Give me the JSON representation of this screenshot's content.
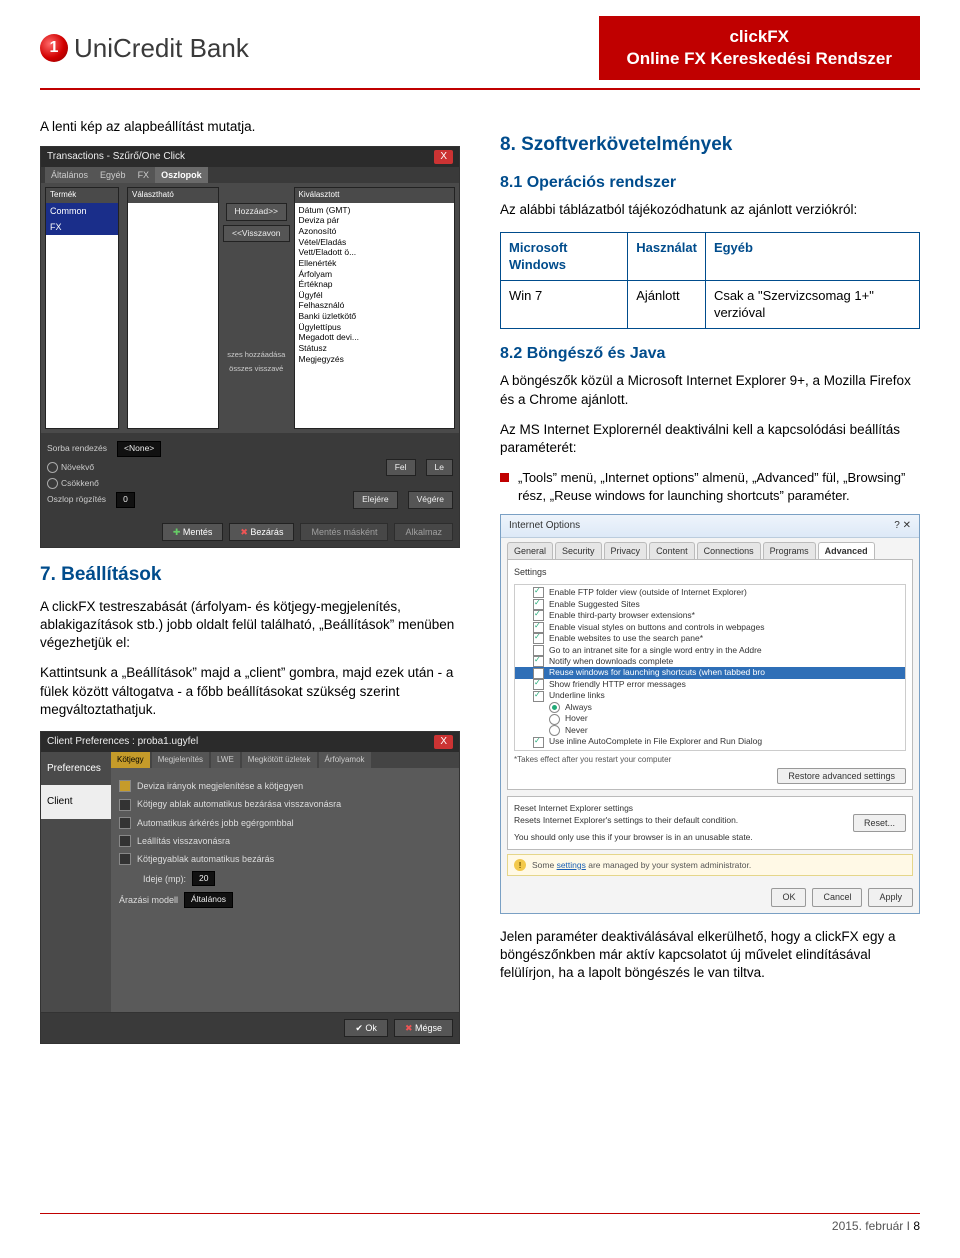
{
  "header": {
    "logo_text": "UniCredit Bank",
    "box_line1": "clickFX",
    "box_line2": "Online FX Kereskedési Rendszer"
  },
  "left": {
    "intro": "A lenti kép az alapbeállítást mutatja.",
    "shot1": {
      "title": "Transactions - Szűrő/One Click",
      "close": "X",
      "tabs": [
        "Általános",
        "Egyéb",
        "FX",
        "Oszlopok"
      ],
      "col1_hdr": "Termék",
      "col1_items": [
        "Common",
        "FX"
      ],
      "col2_hdr": "Választható",
      "col3_hdr": "Kiválasztott",
      "mid_btns": [
        "Hozzáad>>",
        "<<Visszavon"
      ],
      "selected": [
        "Dátum (GMT)",
        "Deviza pár",
        "Azonosító",
        "Vétel/Eladás",
        "Vett/Eladott ö...",
        "Ellenérték",
        "Árfolyam",
        "Értéknap",
        "Ügyfél",
        "Felhasználó",
        "Banki üzletkötő",
        "Ügylettípus",
        "Megadott devi...",
        "Státusz",
        "Megjegyzés"
      ],
      "extra1": "szes hozzáadása",
      "extra2": "összes visszavé",
      "sort_label": "Sorba rendezés",
      "sort_value": "<None>",
      "r_up": "Növekvő",
      "r_down": "Csökkenő",
      "fix_label": "Oszlop rögzítés",
      "fix_value": "0",
      "btns_fl": [
        "Fel",
        "Le"
      ],
      "btns_ev": [
        "Elejére",
        "Végére"
      ],
      "foot": [
        "Mentés",
        "Bezárás",
        "Mentés másként",
        "Alkalmaz"
      ]
    },
    "h7": "7. Beállítások",
    "p7a": "A clickFX testreszabását (árfolyam- és kötjegy-megjelenítés, ablakigazítások stb.) jobb oldalt felül található, „Beállítások” menüben végezhetjük el:",
    "p7b": "Kattintsunk a „Beállítások” majd a „client” gombra, majd ezek után - a fülek között váltogatva - a főbb beállításokat szükség szerint megváltoztathatjuk.",
    "shot2": {
      "title": "Client Preferences : proba1.ugyfel",
      "close": "X",
      "side": [
        "Preferences",
        "Client"
      ],
      "tabs": [
        "Kötjegy",
        "Megjelenítés",
        "LWE",
        "Megkötött üzletek",
        "Árfolyamok"
      ],
      "rows": [
        {
          "on": true,
          "label": "Deviza irányok megjelenítése a kötjegyen"
        },
        {
          "on": false,
          "label": "Kötjegy ablak automatikus bezárása visszavonásra"
        },
        {
          "on": false,
          "label": "Automatikus árkérés jobb egérgombbal"
        },
        {
          "on": false,
          "label": "Leállítás visszavonásra"
        },
        {
          "on": false,
          "label": "Kötjegyablak automatikus bezárás"
        }
      ],
      "time_label": "Ideje (mp):",
      "time_value": "20",
      "model_label": "Árazási modell",
      "model_value": "Általános",
      "foot_ok": "Ok",
      "foot_cancel": "Mégse"
    }
  },
  "right": {
    "h8": "8. Szoftverkövetelmények",
    "h81": "8.1 Operációs rendszer",
    "p81": "Az alábbi táblázatból tájékozódhatunk az ajánlott verziókról:",
    "table": {
      "headers": [
        "Microsoft Windows",
        "Használat",
        "Egyéb"
      ],
      "row": [
        "Win 7",
        "Ajánlott",
        "Csak a \"Szervizcsomag 1+\" verzióval"
      ]
    },
    "h82": "8.2 Böngésző és Java",
    "p82a": "A böngészők közül a Microsoft Internet Explorer 9+, a Mozilla Firefox és a Chrome ajánlott.",
    "p82b": "Az MS Internet Explorernél deaktiválni kell a kapcsolódási beállítás paraméterét:",
    "bullet": "„Tools” menü, „Internet options” almenü, „Advanced” fül, „Browsing” rész, „Reuse windows for launching shortcuts” paraméter.",
    "ie": {
      "title": "Internet Options",
      "tabs": [
        "General",
        "Security",
        "Privacy",
        "Content",
        "Connections",
        "Programs",
        "Advanced"
      ],
      "group": "Settings",
      "rows": [
        {
          "t": "chk",
          "on": true,
          "label": "Enable FTP folder view (outside of Internet Explorer)"
        },
        {
          "t": "chk",
          "on": true,
          "label": "Enable Suggested Sites"
        },
        {
          "t": "chk",
          "on": true,
          "label": "Enable third-party browser extensions*"
        },
        {
          "t": "chk",
          "on": true,
          "label": "Enable visual styles on buttons and controls in webpages"
        },
        {
          "t": "chk",
          "on": true,
          "label": "Enable websites to use the search pane*"
        },
        {
          "t": "chk",
          "on": false,
          "label": "Go to an intranet site for a single word entry in the Addre"
        },
        {
          "t": "chk",
          "on": true,
          "label": "Notify when downloads complete"
        },
        {
          "t": "chk",
          "on": false,
          "hl": true,
          "label": "Reuse windows for launching shortcuts (when tabbed bro"
        },
        {
          "t": "chk",
          "on": true,
          "label": "Show friendly HTTP error messages"
        },
        {
          "t": "chk",
          "on": true,
          "label": "Underline links",
          "indent": false
        },
        {
          "t": "radio",
          "on": true,
          "label": "Always",
          "indent": true
        },
        {
          "t": "radio",
          "on": false,
          "label": "Hover",
          "indent": true
        },
        {
          "t": "radio",
          "on": false,
          "label": "Never",
          "indent": true
        },
        {
          "t": "chk",
          "on": true,
          "label": "Use inline AutoComplete in File Explorer and Run Dialog"
        }
      ],
      "note": "*Takes effect after you restart your computer",
      "restore_btn": "Restore advanced settings",
      "reset_hdr": "Reset Internet Explorer settings",
      "reset_txt": "Resets Internet Explorer's settings to their default condition.",
      "reset_btn": "Reset...",
      "reset_hint": "You should only use this if your browser is in an unusable state.",
      "warn": "Some settings are managed by your system administrator.",
      "foot": [
        "OK",
        "Cancel",
        "Apply"
      ]
    },
    "p_after": "Jelen paraméter deaktiválásával elkerülhető, hogy a clickFX egy a böngészőnkben már aktív kapcsolatot új művelet elindításával felülírjon, ha a lapolt böngészés le van tiltva."
  },
  "footer": {
    "date": "2015. február",
    "sep": " I ",
    "page": "8"
  }
}
